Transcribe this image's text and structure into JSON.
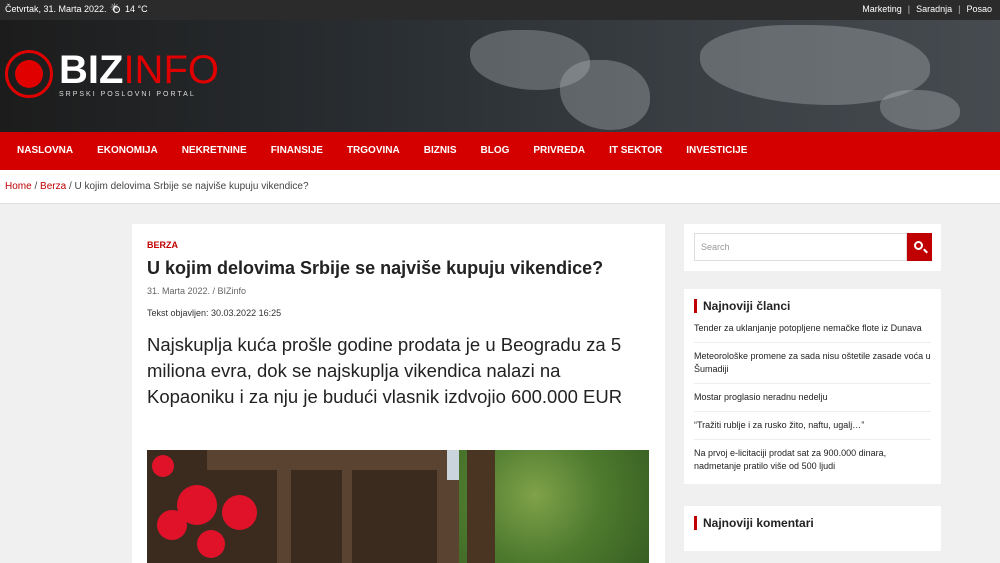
{
  "topbar": {
    "date": "Četvrtak, 31. Marta 2022.",
    "temperature": "14 °C",
    "weather_icon": "sun-icon",
    "links": [
      "Marketing",
      "Saradnja",
      "Posao"
    ],
    "separator": "|"
  },
  "logo": {
    "main_a": "BIZ",
    "main_b": "INFO",
    "subtitle": "SRPSKI POSLOVNI PORTAL"
  },
  "nav": {
    "items": [
      "NASLOVNA",
      "EKONOMIJA",
      "NEKRETNINE",
      "FINANSIJE",
      "TRGOVINA",
      "BIZNIS",
      "BLOG",
      "PRIVREDA",
      "IT SEKTOR",
      "INVESTICIJE"
    ]
  },
  "breadcrumb": {
    "home": "Home",
    "category": "Berza",
    "sep": "/",
    "current": "U kojim delovima Srbije se najviše kupuju vikendice?"
  },
  "article": {
    "category": "BERZA",
    "title": "U kojim delovima Srbije se najviše kupuju vikendice?",
    "meta": "31. Marta 2022. / BIZinfo",
    "published": "Tekst objavljen: 30.03.2022 16:25",
    "lead": "Najskuplja kuća prošle godine prodata je u Beogradu za 5 miliona evra, dok se najskuplja vikendica nalazi na Kopaoniku i za nju je budući vlasnik izdvojio 600.000 EUR"
  },
  "sidebar": {
    "search_placeholder": "Search",
    "search_icon": "search-icon",
    "latest_title": "Najnoviji članci",
    "latest": [
      "Tender za uklanjanje potopljene nemačke flote iz Dunava",
      "Meteorološke promene za sada nisu oštetile zasade voća u Šumadiji",
      "Mostar proglasio neradnu nedelju",
      "“Tražiti rublje i za rusko žito, naftu, ugalj…”",
      "Na prvoj e-licitaciji prodat sat za 900.000 dinara, nadmetanje pratilo više od 500 ljudi"
    ],
    "comments_title": "Najnoviji komentari"
  },
  "colors": {
    "brand_red": "#d40000",
    "topbar": "#2b2b2b"
  }
}
